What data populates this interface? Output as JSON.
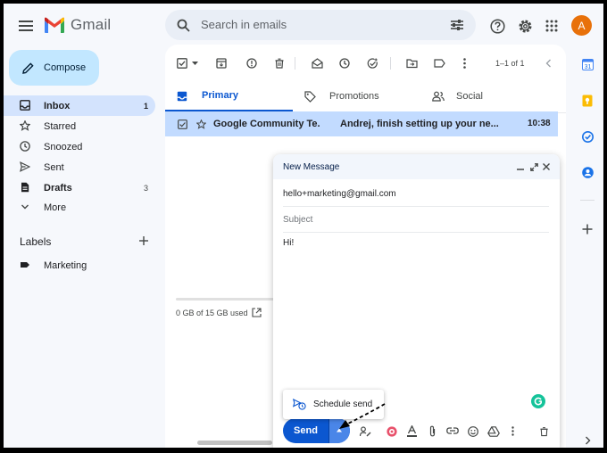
{
  "app": {
    "name": "Gmail",
    "avatar_initial": "A",
    "colors": {
      "accent": "#0b57d0",
      "compose_bg": "#c2e7ff",
      "avatar_bg": "#e8710a"
    }
  },
  "search": {
    "placeholder": "Search in emails"
  },
  "compose": {
    "label": "Compose"
  },
  "sidebar": {
    "items": [
      {
        "label": "Inbox",
        "count": "1",
        "icon": "inbox-icon"
      },
      {
        "label": "Starred",
        "count": "",
        "icon": "star-icon"
      },
      {
        "label": "Snoozed",
        "count": "",
        "icon": "clock-icon"
      },
      {
        "label": "Sent",
        "count": "",
        "icon": "send-icon"
      },
      {
        "label": "Drafts",
        "count": "3",
        "icon": "draft-icon"
      },
      {
        "label": "More",
        "count": "",
        "icon": "chevron-down-icon"
      }
    ],
    "labels_heading": "Labels",
    "labels": [
      {
        "label": "Marketing",
        "icon": "label-icon"
      }
    ]
  },
  "toolbar": {
    "pagination": "1–1 of 1"
  },
  "tabs": [
    {
      "label": "Primary",
      "icon": "inbox-icon"
    },
    {
      "label": "Promotions",
      "icon": "tag-icon"
    },
    {
      "label": "Social",
      "icon": "people-icon"
    }
  ],
  "email_row": {
    "sender": "Google Community Te.",
    "subject": "Andrej, finish setting up your ne...",
    "time": "10:38"
  },
  "storage": {
    "text": "0 GB of 15 GB used"
  },
  "compose_window": {
    "title": "New Message",
    "to": "hello+marketing@gmail.com",
    "subject_placeholder": "Subject",
    "body": "Hi!",
    "send_label": "Send",
    "schedule_send_label": "Schedule send"
  }
}
